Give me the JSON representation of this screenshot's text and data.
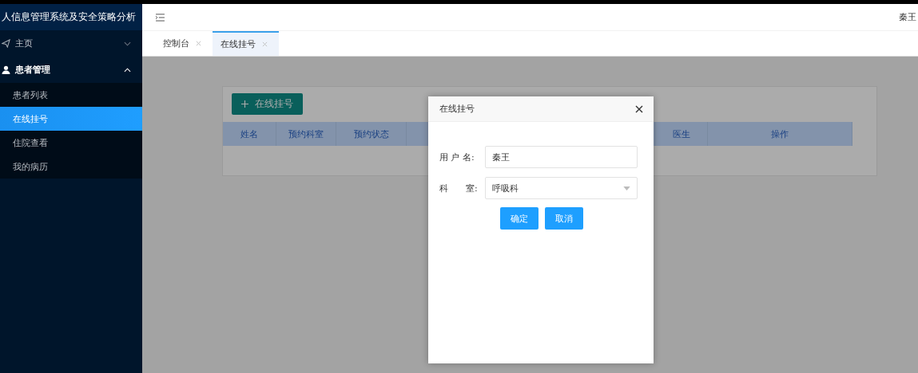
{
  "sidebar": {
    "title": "人信息管理系统及安全策略分析",
    "items": [
      {
        "label": "主页",
        "expanded": false
      },
      {
        "label": "患者管理",
        "expanded": true,
        "children": [
          {
            "label": "患者列表",
            "selected": false
          },
          {
            "label": "在线挂号",
            "selected": true
          },
          {
            "label": "住院查看",
            "selected": false
          },
          {
            "label": "我的病历",
            "selected": false
          }
        ]
      }
    ]
  },
  "topbar": {
    "user": "秦王"
  },
  "tabs": [
    {
      "label": "控制台",
      "selected": false
    },
    {
      "label": "在线挂号",
      "selected": true
    }
  ],
  "add_button": "在线挂号",
  "table": {
    "columns": [
      "姓名",
      "预约科室",
      "预约状态",
      "医生",
      "操作"
    ]
  },
  "dialog": {
    "title": "在线挂号",
    "fields": [
      {
        "kind": "text",
        "label": "用 户 名:",
        "value": "秦王"
      },
      {
        "kind": "select",
        "label": "科　　室:",
        "value": "呼吸科"
      }
    ],
    "buttons": [
      "确定",
      "取消"
    ]
  }
}
